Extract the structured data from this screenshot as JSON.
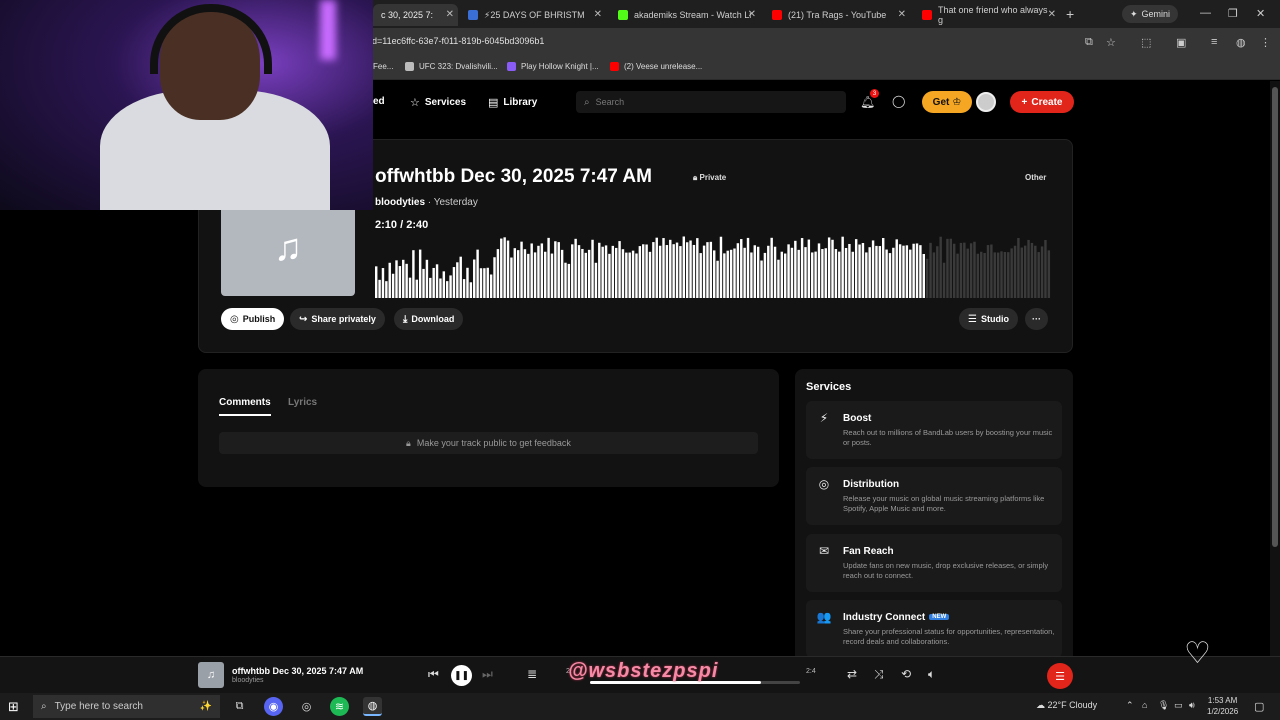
{
  "browser": {
    "tabs": [
      {
        "label": "c 30, 2025 7:",
        "color": "#555",
        "active": true
      },
      {
        "label": "⚡25 DAYS OF BHRISTM",
        "color": "#3a6fd8",
        "active": false
      },
      {
        "label": "akademiks Stream - Watch Li",
        "color": "#53fc18",
        "active": false
      },
      {
        "label": "(21) Tra Rags - YouTube",
        "color": "#ff0000",
        "active": false
      },
      {
        "label": "That one friend who always g",
        "color": "#ff0000",
        "active": false
      }
    ],
    "gemini_label": "Gemini",
    "url": "d=11ec6ffc-63e7-f011-819b-6045bd3096b1",
    "bookmarks": [
      {
        "label": "Fee...",
        "color": "#888"
      },
      {
        "label": "UFC 323: Dvalishvili...",
        "color": "#bbb"
      },
      {
        "label": "Play Hollow Knight |...",
        "color": "#8a5cf6"
      },
      {
        "label": "(2) Veese unrelease...",
        "color": "#ff0000"
      }
    ]
  },
  "nav": {
    "partial_label": "ed",
    "services_label": "Services",
    "library_label": "Library",
    "search_placeholder": "Search",
    "notification_count": "3",
    "get_label": "Get",
    "create_label": "Create"
  },
  "track": {
    "title": "offwhtbb Dec 30, 2025 7:47 AM",
    "privacy": "Private",
    "genre": "Other",
    "artist": "bloodyties",
    "posted": "Yesterday",
    "current_time": "2:10",
    "duration": "2:40",
    "progress": 0.8125,
    "actions": {
      "publish": "Publish",
      "share": "Share privately",
      "download": "Download",
      "studio": "Studio",
      "more": "···"
    }
  },
  "comments": {
    "tabs": [
      "Comments",
      "Lyrics"
    ],
    "note": "Make your track public to get feedback"
  },
  "services": {
    "heading": "Services",
    "items": [
      {
        "icon": "⚡",
        "name": "Boost",
        "badge": "",
        "desc": "Reach out to millions of BandLab users by boosting your music or posts."
      },
      {
        "icon": "◎",
        "name": "Distribution",
        "badge": "",
        "desc": "Release your music on global music streaming platforms like Spotify, Apple Music and more."
      },
      {
        "icon": "✉",
        "name": "Fan Reach",
        "badge": "",
        "desc": "Update fans on new music, drop exclusive releases, or simply reach out to connect."
      },
      {
        "icon": "👥",
        "name": "Industry Connect",
        "badge": "NEW",
        "desc": "Share your professional status for opportunities, representation, record deals and collaborations."
      }
    ]
  },
  "player": {
    "title": "offwhtbb Dec 30, 2025 7:47 AM",
    "artist": "bloodyties",
    "elapsed": "2:",
    "duration": "2:4",
    "progress": 0.8125
  },
  "overlay_text": "@wsbstezpspi",
  "taskbar": {
    "search_placeholder": "Type here to search",
    "weather": "22°F  Cloudy",
    "time": "1:53 AM",
    "date": "1/2/2026"
  },
  "colors": {
    "accent_red": "#e1251b",
    "get_orange": "#f5a623",
    "badge_blue": "#2f7de1"
  }
}
